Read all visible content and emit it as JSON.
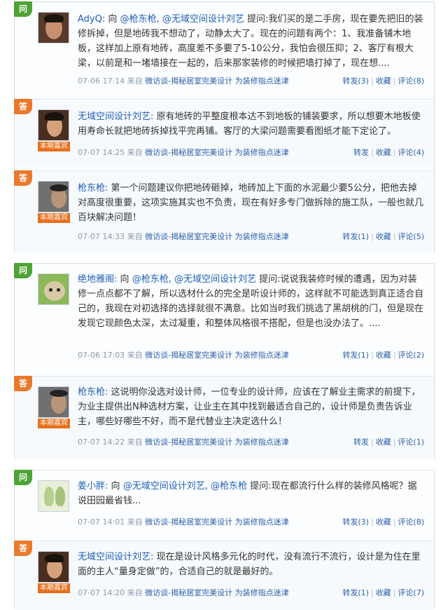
{
  "question_blocks": [
    {
      "question": {
        "badge": "问",
        "author": "AdyQ:",
        "to": "向",
        "mentions": [
          "@枪东枪,",
          "@无域空间设计刘艺"
        ],
        "text": "提问:我们买的是二手房，现在要先把旧的装修拆掉，但是地砖我不想动了，动静太大了。现在的问题有两个：1、我准备铺木地板，这样加上原有地砖，高度差不多要了5-10公分，我怕会很压抑；2、客厅有根大梁，以前是和一堵墙接在一起的，后来那家装修的时候把墙打掉了，现在想....",
        "time": "07-06 17:14",
        "from": "来自",
        "source": "微访谈-揭秘居室完美设计",
        "source2": "为装修指点迷津",
        "forward": "转发(3)",
        "fav": "收藏",
        "comment": "评论(8)"
      },
      "answers": [
        {
          "badge": "答",
          "guest_tag": "本期嘉宾",
          "author": "无域空间设计刘艺:",
          "text": "原有地砖的平整度根本达不到地板的铺装要求，所以想要木地板使用寿命长就把地砖拆掉找平完再铺。客厅的大梁问题需要看图纸才能下定论了。",
          "time": "07-07 14:25",
          "from": "来自",
          "source": "微访谈-揭秘居室完美设计",
          "source2": "为装修指点迷津",
          "forward": "转发",
          "fav": "收藏",
          "comment": "评论(4)"
        },
        {
          "badge": "答",
          "guest_tag": "本期嘉宾",
          "author": "枪东枪:",
          "text": "第一个问题建议你把地砖砸掉，地砖加上下面的水泥最少要5公分，把他去掉对高度很重要，这项实施其实也不负责，现在有好多专门做拆除的施工队，一般也就几百块解决问题！",
          "time": "07-07 14:33",
          "from": "来自",
          "source": "微访谈-揭秘居室完美设计",
          "source2": "为装修指点迷津",
          "forward": "转发(1)",
          "fav": "收藏",
          "comment": "评论(5)"
        }
      ]
    },
    {
      "question": {
        "badge": "问",
        "author": "绝地雅阁:",
        "to": "向",
        "mentions": [
          "@枪东枪,",
          "@无域空间设计刘艺"
        ],
        "text": "提问:说说我装修时候的遭遇，因为对装修一点点都不了解，所以选材什么的完全是听设计师的，这样就不可能选到真正适合自己的，我现在对初选择的选择就很不满意。比如当时我们挑选了黑胡桃的门，但是现在发现它现颜色太深，太过凝重，和整体风格很不搭配，但是也没办法了。....",
        "time": "07-06 17:03",
        "from": "来自",
        "source": "微访谈-揭秘居室完美设计",
        "source2": "为装修指点迷津",
        "forward": "转发(1)",
        "fav": "收藏",
        "comment": "评论(2)"
      },
      "answers": [
        {
          "badge": "答",
          "guest_tag": "本期嘉宾",
          "author": "枪东枪:",
          "text": "这说明你没选对设计师，一位专业的设计师，应该在了解业主需求的前提下，为业主提供出N种选材方案，让业主在其中找到最适合自己的，设计师是负责告诉业主，哪些好哪些不好，而不是代替业主决定选什么！",
          "time": "07-07 14:22",
          "from": "来自",
          "source": "微访谈-揭秘居室完美设计",
          "source2": "为装修指点迷津",
          "forward": "转发",
          "fav": "收藏",
          "comment": "评论(1)"
        }
      ]
    },
    {
      "question": {
        "badge": "问",
        "author": "姜小胖:",
        "to": "向",
        "mentions": [
          "@无域空间设计刘艺,",
          "@枪东枪"
        ],
        "text": "提问:现在都流行什么样的装修风格呢？据说田园最省钱...",
        "time": "07-07 14:01",
        "from": "来自",
        "source": "微访谈-揭秘居室完美设计",
        "source2": "为装修指点迷津",
        "forward": "转发(3)",
        "fav": "收藏",
        "comment": "评论(8)"
      },
      "answers": [
        {
          "badge": "答",
          "guest_tag": "本期嘉宾",
          "author": "无域空间设计刘艺:",
          "text": "现在是设计风格多元化的时代，没有流行不流行，设计是为住在里面的主人“量身定做”的，合适自己的就是最好的。",
          "time": "07-07 14:20",
          "from": "来自",
          "source": "微访谈-揭秘居室完美设计",
          "source2": "为装修指点迷津",
          "forward": "转发(1)",
          "fav": "收藏",
          "comment": "评论(7)"
        }
      ]
    }
  ],
  "colors": {
    "question_badge": "#4da435",
    "answer_badge": "#e9792b",
    "link": "#1f5fb5",
    "guest_tag": "#e86f1c"
  }
}
